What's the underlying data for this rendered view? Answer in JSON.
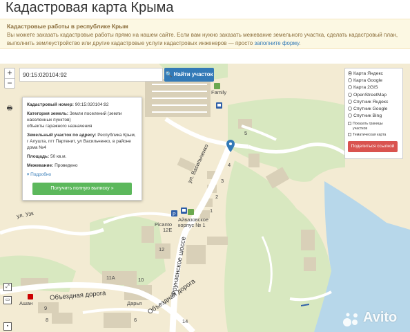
{
  "page": {
    "title": "Кадастровая карта Крыма"
  },
  "notice": {
    "title": "Кадастровые работы в республике Крым",
    "text": "Вы можете заказать кадастровые работы прямо на нашем сайте. Если вам нужно заказать межевание земельного участка, сделать кадастровый план, выполнить землеустройство или другие кадастровые услуги кадастровых инженеров — просто",
    "link": "заполните форму",
    "suffix": "."
  },
  "map_controls": {
    "zoom_in": "+",
    "zoom_out": "−",
    "print": "🖶"
  },
  "search": {
    "value": "90:15:020104:92",
    "button": "Найти участок"
  },
  "info": {
    "cadastral_label": "Кадастровый номер:",
    "cadastral_value": "90:15:020104:92",
    "category_label": "Категория земель:",
    "category_value": "Земли поселений (земли населенных пунктов)",
    "use_value": "объекты гаражного назначения",
    "address_label": "Земельный участок по адресу:",
    "address_value": "Республика Крым, г Алушта, пгт Партенит, ул Васильченко, в районе дома №4",
    "area_label": "Площадь:",
    "area_value": "50 кв.м.",
    "survey_label": "Межевание:",
    "survey_value": "Проведено",
    "details": "Подробно",
    "extract_button": "Получить полную выписку »"
  },
  "layers": {
    "options": [
      {
        "label": "Карта Яндекс",
        "selected": true
      },
      {
        "label": "Карта Google",
        "selected": false
      },
      {
        "label": "Карта 2GIS",
        "selected": false
      },
      {
        "label": "OpenStreetMap",
        "selected": false
      },
      {
        "label": "Спутник Яндекс",
        "selected": false
      },
      {
        "label": "Спутник Google",
        "selected": false
      },
      {
        "label": "Спутник Bing",
        "selected": false
      }
    ],
    "show_borders": "Показать границы участков",
    "thematic_map": "Тематическая карта",
    "share_button": "Поделиться ссылкой"
  },
  "map_labels": {
    "family": "Family",
    "picanto": "Picanto",
    "corpus": "Айвазовское корпус № 1",
    "street_vasilchenko": "ул. Васильченко",
    "street_frunzenskoe": "Фрунзенское шоссе",
    "street_obezdnaya": "Объездная дорога",
    "street_obezdnaya2": "Объездная дорога",
    "street_uzk": "ул. Узк",
    "dasha": "Дарья",
    "ashan": "Ашан",
    "num_5": "5",
    "num_4": "4",
    "num_3": "3",
    "num_2": "2",
    "num_1": "1",
    "num_12": "12",
    "num_12e": "12Е",
    "num_11a": "11А",
    "num_10": "10",
    "num_9": "9",
    "num_8": "8",
    "num_6": "6",
    "num_14": "14"
  },
  "watermark": {
    "text": "Avito"
  },
  "colors": {
    "map_bg": "#f3ebd3",
    "road": "#ffffff",
    "green": "#d8e8c0",
    "building": "#d9d0b8",
    "sea": "#b7d7ea",
    "primary": "#337ab7",
    "success": "#5cb85c",
    "danger": "#d9534f",
    "notice_bg": "#fcf8e3"
  }
}
